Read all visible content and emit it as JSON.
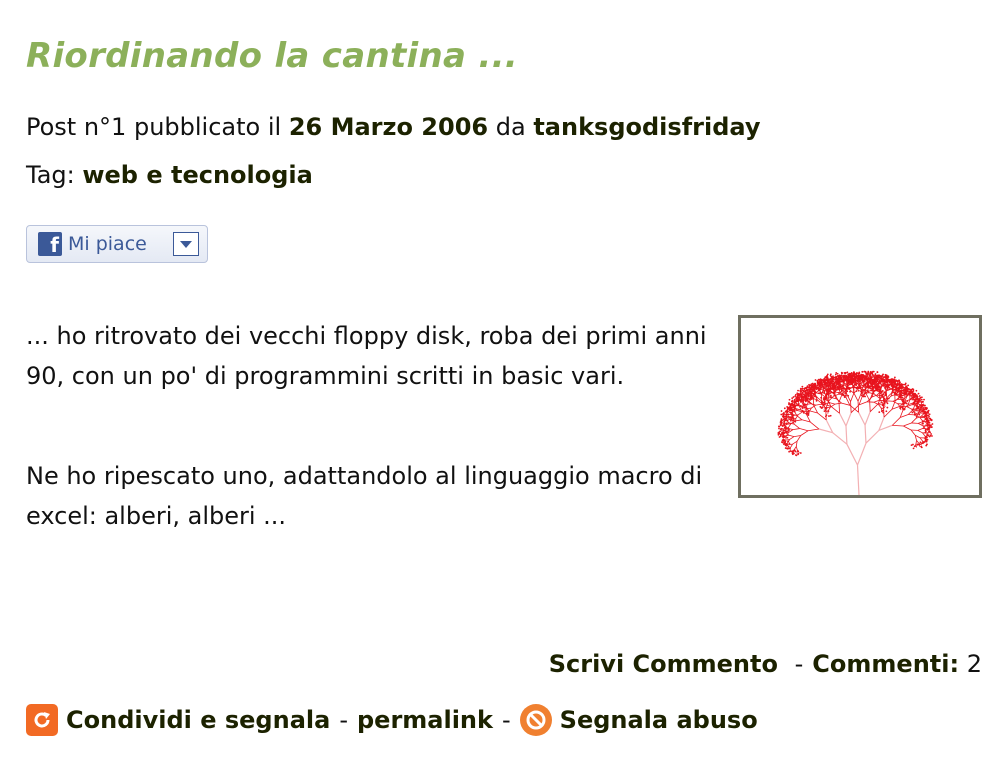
{
  "post": {
    "title": "Riordinando la cantina ...",
    "meta_prefix": "Post n°1 pubblicato il",
    "date": "26 Marzo 2006",
    "by": "da",
    "author": "tanksgodisfriday",
    "tag_label": "Tag:",
    "tag": "web e tecnologia",
    "paragraph1": "... ho ritrovato dei vecchi floppy disk, roba dei primi anni 90, con un po' di programmini scritti in basic vari.",
    "paragraph2": "Ne ho ripescato uno, adattandolo al linguaggio macro di excel: alberi, alberi ..."
  },
  "like_button": {
    "label": "Mi piace",
    "icon": "facebook-icon"
  },
  "footer": {
    "write_comment": "Scrivi Commento",
    "comments_label": "Commenti:",
    "comments_count": "2",
    "share": "Condividi e segnala",
    "permalink": "permalink",
    "report_abuse": "Segnala abuso",
    "separator": "-"
  },
  "colors": {
    "title": "#8cb05a",
    "link": "#1c2200",
    "tree": "#e8141e"
  }
}
